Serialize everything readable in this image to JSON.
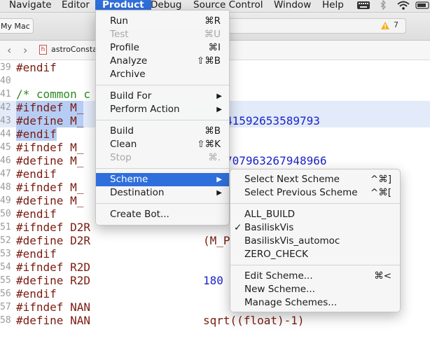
{
  "menubar": {
    "items": [
      "Navigate",
      "Editor",
      "Product",
      "Debug",
      "Source Control",
      "Window",
      "Help"
    ],
    "active": "Product"
  },
  "toolbar": {
    "scheme_label": "My Mac",
    "warnings": "7"
  },
  "jumpbar": {
    "file_icon": "h",
    "file_name": "astroConsta"
  },
  "editor": {
    "lines": [
      {
        "num": "39",
        "code": "#endif"
      },
      {
        "num": "40",
        "code": ""
      },
      {
        "num": "41",
        "code": "/* common c"
      },
      {
        "num": "42",
        "code": "#ifndef M_"
      },
      {
        "num": "43",
        "code": "#define M_"
      },
      {
        "num": "44",
        "code": "#endif"
      },
      {
        "num": "45",
        "code": "#ifndef M_"
      },
      {
        "num": "46",
        "code": "#define M_"
      },
      {
        "num": "47",
        "code": "#endif"
      },
      {
        "num": "48",
        "code": "#ifndef M_"
      },
      {
        "num": "49",
        "code": "#define M_"
      },
      {
        "num": "50",
        "code": "#endif"
      },
      {
        "num": "51",
        "code": "#ifndef D2R"
      },
      {
        "num": "52",
        "code": "#define D2R"
      },
      {
        "num": "53",
        "code": "#endif"
      },
      {
        "num": "54",
        "code": "#ifndef R2D"
      },
      {
        "num": "55",
        "code": "#define R2D"
      },
      {
        "num": "56",
        "code": "#endif"
      },
      {
        "num": "57",
        "code": "#ifndef NAN"
      },
      {
        "num": "58",
        "code": "#define NAN"
      }
    ],
    "values": {
      "line43": "41592653589793",
      "line46": "707963267948966",
      "line52": "(M_P",
      "line55": "180",
      "line58": "sqrt((float)-1)"
    }
  },
  "product_menu": {
    "items": [
      {
        "label": "Run",
        "shortcut": "⌘R"
      },
      {
        "label": "Test",
        "shortcut": "⌘U",
        "disabled": true
      },
      {
        "label": "Profile",
        "shortcut": "⌘I"
      },
      {
        "label": "Analyze",
        "shortcut": "⇧⌘B"
      },
      {
        "label": "Archive",
        "shortcut": ""
      },
      {
        "label": "Build For",
        "submenu": true
      },
      {
        "label": "Perform Action",
        "submenu": true
      },
      {
        "label": "Build",
        "shortcut": "⌘B"
      },
      {
        "label": "Clean",
        "shortcut": "⇧⌘K"
      },
      {
        "label": "Stop",
        "shortcut": "⌘.",
        "disabled": true
      },
      {
        "label": "Scheme",
        "submenu": true,
        "active": true
      },
      {
        "label": "Destination",
        "submenu": true
      },
      {
        "label": "Create Bot...",
        "shortcut": ""
      }
    ]
  },
  "scheme_menu": {
    "items": [
      {
        "label": "Select Next Scheme",
        "shortcut": "^⌘]"
      },
      {
        "label": "Select Previous Scheme",
        "shortcut": "^⌘["
      },
      {
        "label": "ALL_BUILD",
        "checked": false
      },
      {
        "label": "BasiliskVis",
        "checked": true
      },
      {
        "label": "BasiliskVis_automoc",
        "checked": false
      },
      {
        "label": "ZERO_CHECK",
        "checked": false
      },
      {
        "label": "Edit Scheme...",
        "shortcut": "⌘<"
      },
      {
        "label": "New Scheme...",
        "shortcut": ""
      },
      {
        "label": "Manage Schemes...",
        "shortcut": ""
      }
    ],
    "check_mark": "✓"
  },
  "colors": {
    "accent": "#2f6fdc",
    "keyword": "#7a1b10",
    "comment": "#2c8a22",
    "number": "#1c25c8",
    "highlight": "#e3ebfa"
  }
}
